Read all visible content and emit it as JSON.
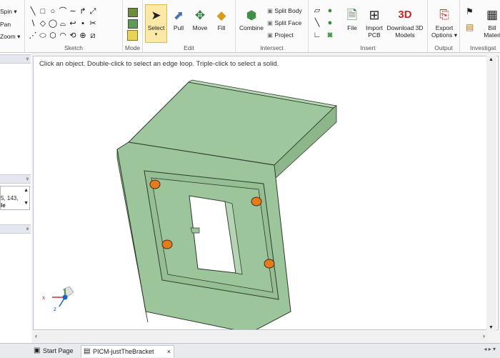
{
  "ribbon": {
    "view_tools": [
      "Spin",
      "Pan",
      "Zoom"
    ],
    "groups": {
      "sketch": "Sketch",
      "mode": "Mode",
      "edit": "Edit",
      "intersect": "Intersect",
      "insert": "Insert",
      "output": "Output",
      "investigate": "Investigat"
    },
    "buttons": {
      "select": "Select",
      "pull": "Pull",
      "move": "Move",
      "fill": "Fill",
      "combine": "Combine",
      "split_body": "Split Body",
      "split_face": "Split Face",
      "project": "Project",
      "file": "File",
      "import_pcb_1": "Import",
      "import_pcb_2": "PCB",
      "download_3d_1": "Download 3D",
      "download_3d_2": "Models",
      "export_1": "Export",
      "export_2": "Options",
      "bill_1": "Bill",
      "bill_2": "Materi"
    },
    "download_3d_badge": "3D"
  },
  "left_panel": {
    "row_text": "5, 143,",
    "row_text2": "le"
  },
  "viewport": {
    "hint": "Click an object. Double-click to select an edge loop. Triple-click to select a solid."
  },
  "tabs": [
    {
      "label": "Start Page"
    },
    {
      "label": "PICM-justTheBracket"
    }
  ],
  "colors": {
    "body_face": "#9dc59b",
    "body_top": "#8fb48c",
    "holes": "#e57b1d",
    "selected": "#fde9a7"
  }
}
